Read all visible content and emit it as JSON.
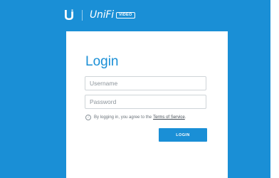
{
  "colors": {
    "brand_blue": "#1a8fd6",
    "page_white": "#ffffff",
    "input_border": "#cfd4d8",
    "muted_text": "#6b737a"
  },
  "header": {
    "logo_icon": "ubiquiti-u-logo",
    "brand_name": "UniFi",
    "badge": "VIDEO"
  },
  "login": {
    "title": "Login",
    "username_placeholder": "Username",
    "password_placeholder": "Password",
    "terms_prefix": "By logging in, you agree to the",
    "terms_link": "Terms of Service",
    "terms_suffix": ".",
    "info_icon": "info-icon",
    "button_label": "LOGIN"
  }
}
